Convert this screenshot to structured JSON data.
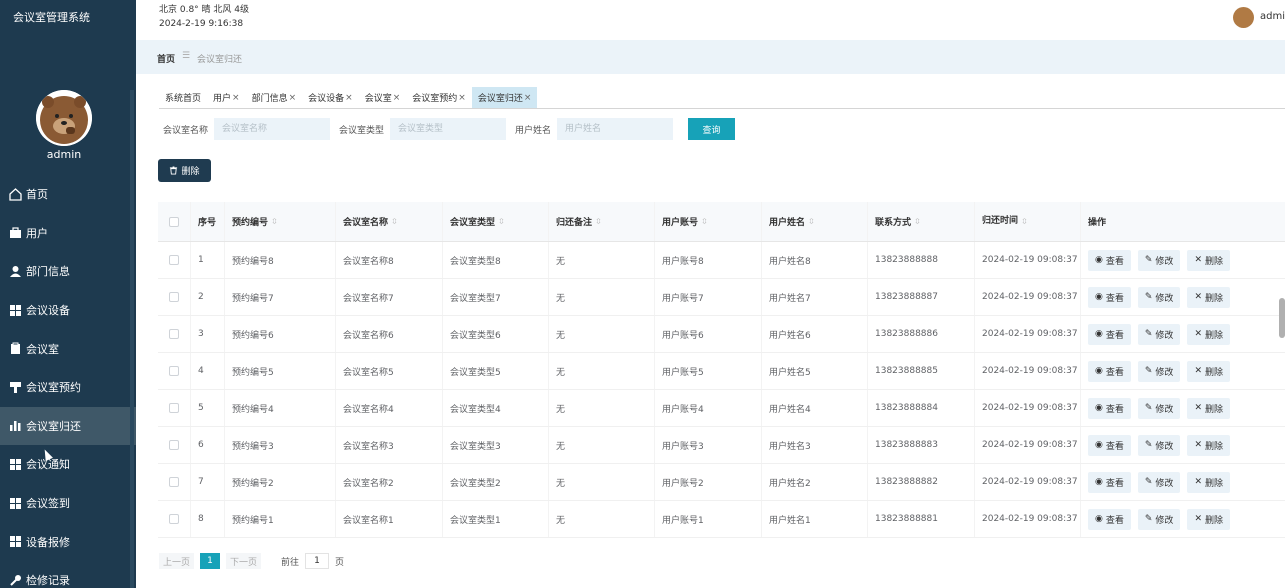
{
  "app": {
    "title": "会议室管理系统"
  },
  "sidebar": {
    "username": "admin",
    "active_index": 6,
    "items": [
      {
        "label": "首页",
        "icon": "home-icon"
      },
      {
        "label": "用户",
        "icon": "briefcase-icon"
      },
      {
        "label": "部门信息",
        "icon": "person-icon"
      },
      {
        "label": "会议设备",
        "icon": "grid-icon"
      },
      {
        "label": "会议室",
        "icon": "clipboard-icon"
      },
      {
        "label": "会议室预约",
        "icon": "stamp-icon"
      },
      {
        "label": "会议室归还",
        "icon": "bar-chart-icon"
      },
      {
        "label": "会议通知",
        "icon": "grid-icon"
      },
      {
        "label": "会议签到",
        "icon": "grid-icon"
      },
      {
        "label": "设备报修",
        "icon": "grid-icon"
      },
      {
        "label": "检修记录",
        "icon": "wrench-icon"
      }
    ]
  },
  "topbar": {
    "weather": "北京  0.8°  晴  北风  4级",
    "datetime": "2024-2-19 9:16:38",
    "user": "admi"
  },
  "breadcrumb": {
    "home": "首页",
    "separator": "☰",
    "current": "会议室归还"
  },
  "tabs": [
    {
      "label": "系统首页",
      "closable": false
    },
    {
      "label": "用户",
      "closable": true
    },
    {
      "label": "部门信息",
      "closable": true
    },
    {
      "label": "会议设备",
      "closable": true
    },
    {
      "label": "会议室",
      "closable": true
    },
    {
      "label": "会议室预约",
      "closable": true
    },
    {
      "label": "会议室归还",
      "closable": true,
      "active": true
    }
  ],
  "search": {
    "room_name_label": "会议室名称",
    "room_name_placeholder": "会议室名称",
    "room_type_label": "会议室类型",
    "room_type_placeholder": "会议室类型",
    "user_name_label": "用户姓名",
    "user_name_placeholder": "用户姓名",
    "button": "查询"
  },
  "toolbar": {
    "delete_label": "删除"
  },
  "table": {
    "headers": {
      "index": "序号",
      "booking_no": "预约编号",
      "room_name": "会议室名称",
      "room_type": "会议室类型",
      "remark": "归还备注",
      "account": "用户账号",
      "user_name": "用户姓名",
      "phone": "联系方式",
      "return_time": "归还时间",
      "actions": "操作"
    },
    "sort_glyph": "⇳",
    "actions": {
      "view": "查看",
      "edit": "修改",
      "delete": "删除"
    },
    "rows": [
      {
        "index": "1",
        "booking_no": "预约编号8",
        "room_name": "会议室名称8",
        "room_type": "会议室类型8",
        "remark": "无",
        "account": "用户账号8",
        "user_name": "用户姓名8",
        "phone": "13823888888",
        "return_time": "2024-02-19 09:08:37"
      },
      {
        "index": "2",
        "booking_no": "预约编号7",
        "room_name": "会议室名称7",
        "room_type": "会议室类型7",
        "remark": "无",
        "account": "用户账号7",
        "user_name": "用户姓名7",
        "phone": "13823888887",
        "return_time": "2024-02-19 09:08:37"
      },
      {
        "index": "3",
        "booking_no": "预约编号6",
        "room_name": "会议室名称6",
        "room_type": "会议室类型6",
        "remark": "无",
        "account": "用户账号6",
        "user_name": "用户姓名6",
        "phone": "13823888886",
        "return_time": "2024-02-19 09:08:37"
      },
      {
        "index": "4",
        "booking_no": "预约编号5",
        "room_name": "会议室名称5",
        "room_type": "会议室类型5",
        "remark": "无",
        "account": "用户账号5",
        "user_name": "用户姓名5",
        "phone": "13823888885",
        "return_time": "2024-02-19 09:08:37"
      },
      {
        "index": "5",
        "booking_no": "预约编号4",
        "room_name": "会议室名称4",
        "room_type": "会议室类型4",
        "remark": "无",
        "account": "用户账号4",
        "user_name": "用户姓名4",
        "phone": "13823888884",
        "return_time": "2024-02-19 09:08:37"
      },
      {
        "index": "6",
        "booking_no": "预约编号3",
        "room_name": "会议室名称3",
        "room_type": "会议室类型3",
        "remark": "无",
        "account": "用户账号3",
        "user_name": "用户姓名3",
        "phone": "13823888883",
        "return_time": "2024-02-19 09:08:37"
      },
      {
        "index": "7",
        "booking_no": "预约编号2",
        "room_name": "会议室名称2",
        "room_type": "会议室类型2",
        "remark": "无",
        "account": "用户账号2",
        "user_name": "用户姓名2",
        "phone": "13823888882",
        "return_time": "2024-02-19 09:08:37"
      },
      {
        "index": "8",
        "booking_no": "预约编号1",
        "room_name": "会议室名称1",
        "room_type": "会议室类型1",
        "remark": "无",
        "account": "用户账号1",
        "user_name": "用户姓名1",
        "phone": "13823888881",
        "return_time": "2024-02-19 09:08:37"
      }
    ]
  },
  "pagination": {
    "prev": "上一页",
    "current": "1",
    "next": "下一页",
    "goto": "前往",
    "goto_value": "1",
    "page_unit": "页"
  },
  "colors": {
    "sidebar_bg": "#1e3a4f",
    "accent": "#17a2b8",
    "active_tab": "#cfe7f3"
  }
}
